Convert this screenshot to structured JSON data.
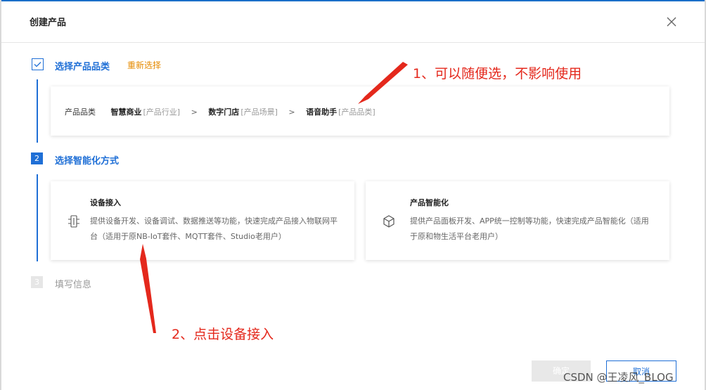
{
  "dialog": {
    "title": "创建产品",
    "close_icon": "close-icon"
  },
  "steps": [
    {
      "number": "",
      "title": "选择产品品类",
      "state": "done",
      "action": "重新选择"
    },
    {
      "number": "2",
      "title": "选择智能化方式",
      "state": "active"
    },
    {
      "number": "3",
      "title": "填写信息",
      "state": "pending"
    }
  ],
  "category": {
    "label": "产品品类",
    "items": [
      {
        "name": "智慧商业",
        "tag": "[产品行业]"
      },
      {
        "name": "数字门店",
        "tag": "[产品场景]"
      },
      {
        "name": "语音助手",
        "tag": "[产品品类]"
      }
    ],
    "separator": ">"
  },
  "methods": [
    {
      "title": "设备接入",
      "icon": "device-access-icon",
      "desc": "提供设备开发、设备调试、数据推送等功能，快速完成产品接入物联网平台（适用于原NB-IoT套件、MQTT套件、Studio老用户）"
    },
    {
      "title": "产品智能化",
      "icon": "cube-icon",
      "desc": "提供产品面板开发、APP统一控制等功能，快速完成产品智能化（适用于原和物生活平台老用户）"
    }
  ],
  "annotations": {
    "note1": "1、可以随便选，不影响使用",
    "note2": "2、点击设备接入"
  },
  "footer": {
    "confirm": "确定",
    "cancel": "取消"
  },
  "watermark": "CSDN @王凌风_BLOG",
  "colors": {
    "primary": "#1f6fd6",
    "accent": "#e58a00",
    "annotation": "#e4281c"
  }
}
